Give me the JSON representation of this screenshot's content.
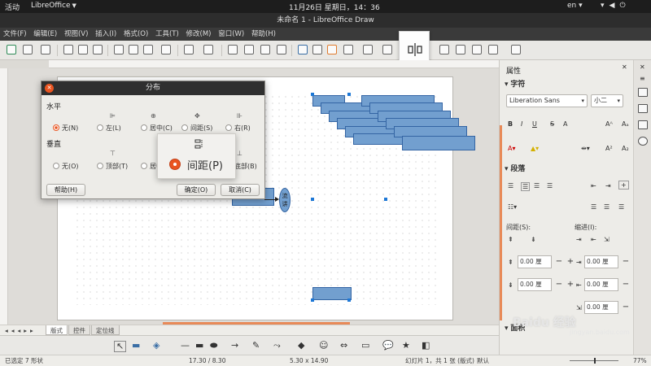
{
  "system_bar": {
    "activities": "活动",
    "app_menu": "LibreOffice",
    "clock": "11月26日 星期日，14：36",
    "language": "en",
    "tray_icons": [
      "wifi-icon",
      "volume-icon",
      "power-icon"
    ]
  },
  "window": {
    "title": "未命名 1 - LibreOffice Draw"
  },
  "menubar": [
    "文件(F)",
    "编辑(E)",
    "视图(V)",
    "插入(I)",
    "格式(O)",
    "工具(T)",
    "修改(M)",
    "窗口(W)",
    "帮助(H)"
  ],
  "dialog": {
    "title": "分布",
    "horizontal": {
      "label": "水平",
      "options": [
        "无(N)",
        "左(L)",
        "居中(C)",
        "间距(S)",
        "右(R)"
      ],
      "selected": "无(N)"
    },
    "vertical": {
      "label": "垂直",
      "options": [
        "无(O)",
        "顶部(T)",
        "居中",
        "间距",
        "底部(B)"
      ],
      "selected": "无(O)"
    },
    "buttons": {
      "help": "帮助(H)",
      "ok": "确定(O)",
      "cancel": "取消(C)"
    }
  },
  "magnifier": {
    "label": "间距(P)"
  },
  "canvas": {
    "ellipse_text": "流\n讲"
  },
  "sheet_tabs": [
    "版式",
    "控件",
    "定位线"
  ],
  "sidebar": {
    "title": "属性",
    "character_header": "字符",
    "font_name": "Liberation Sans",
    "font_size": "小二",
    "paragraph_header": "段落",
    "spacing_label": "间距(S):",
    "indent_label": "缩进(I):",
    "spin_value": "0.00 厘",
    "bottom_header": "面积"
  },
  "statusbar": {
    "selection": "已选定 7 形状",
    "position": "17.30 / 8.30",
    "size": "5.30 x 14.90",
    "slide": "幻灯片 1，共 1 张 (版式)",
    "master": "默认",
    "zoom": "77%"
  },
  "watermark": {
    "main": "Baidu 经验",
    "sub": "jingyan.baidu.com"
  },
  "colors": {
    "accent": "#e95420",
    "shape_fill": "#729fcf",
    "shape_border": "#3465a4",
    "scroll": "#e88a58"
  }
}
